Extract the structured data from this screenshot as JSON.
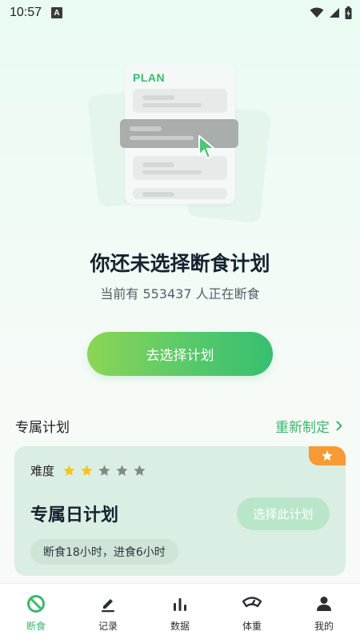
{
  "status_bar": {
    "time": "10:57",
    "notification_icon": "A"
  },
  "illustration": {
    "label": "PLAN",
    "cursor_color": "#4fc775"
  },
  "empty_state": {
    "headline": "你还未选择断食计划",
    "subline": "当前有 553437 人正在断食",
    "button_label": "去选择计划"
  },
  "section": {
    "title": "专属计划",
    "link_label": "重新制定"
  },
  "plan_card": {
    "difficulty_label": "难度",
    "difficulty_rating": 2,
    "difficulty_max": 5,
    "name": "专属日计划",
    "select_label": "选择此计划",
    "tag": "断食18小时，进食6小时",
    "badge_icon": "star-icon"
  },
  "tabs": [
    {
      "label": "断食",
      "icon": "fasting-icon",
      "active": true
    },
    {
      "label": "记录",
      "icon": "pencil-icon",
      "active": false
    },
    {
      "label": "数据",
      "icon": "bar-chart-icon",
      "active": false
    },
    {
      "label": "体重",
      "icon": "scale-icon",
      "active": false
    },
    {
      "label": "我的",
      "icon": "person-icon",
      "active": false
    }
  ],
  "colors": {
    "accent": "#3cb86c",
    "badge": "#f79a34",
    "star_active": "#f5c518",
    "star_inactive": "#7d8a86"
  }
}
